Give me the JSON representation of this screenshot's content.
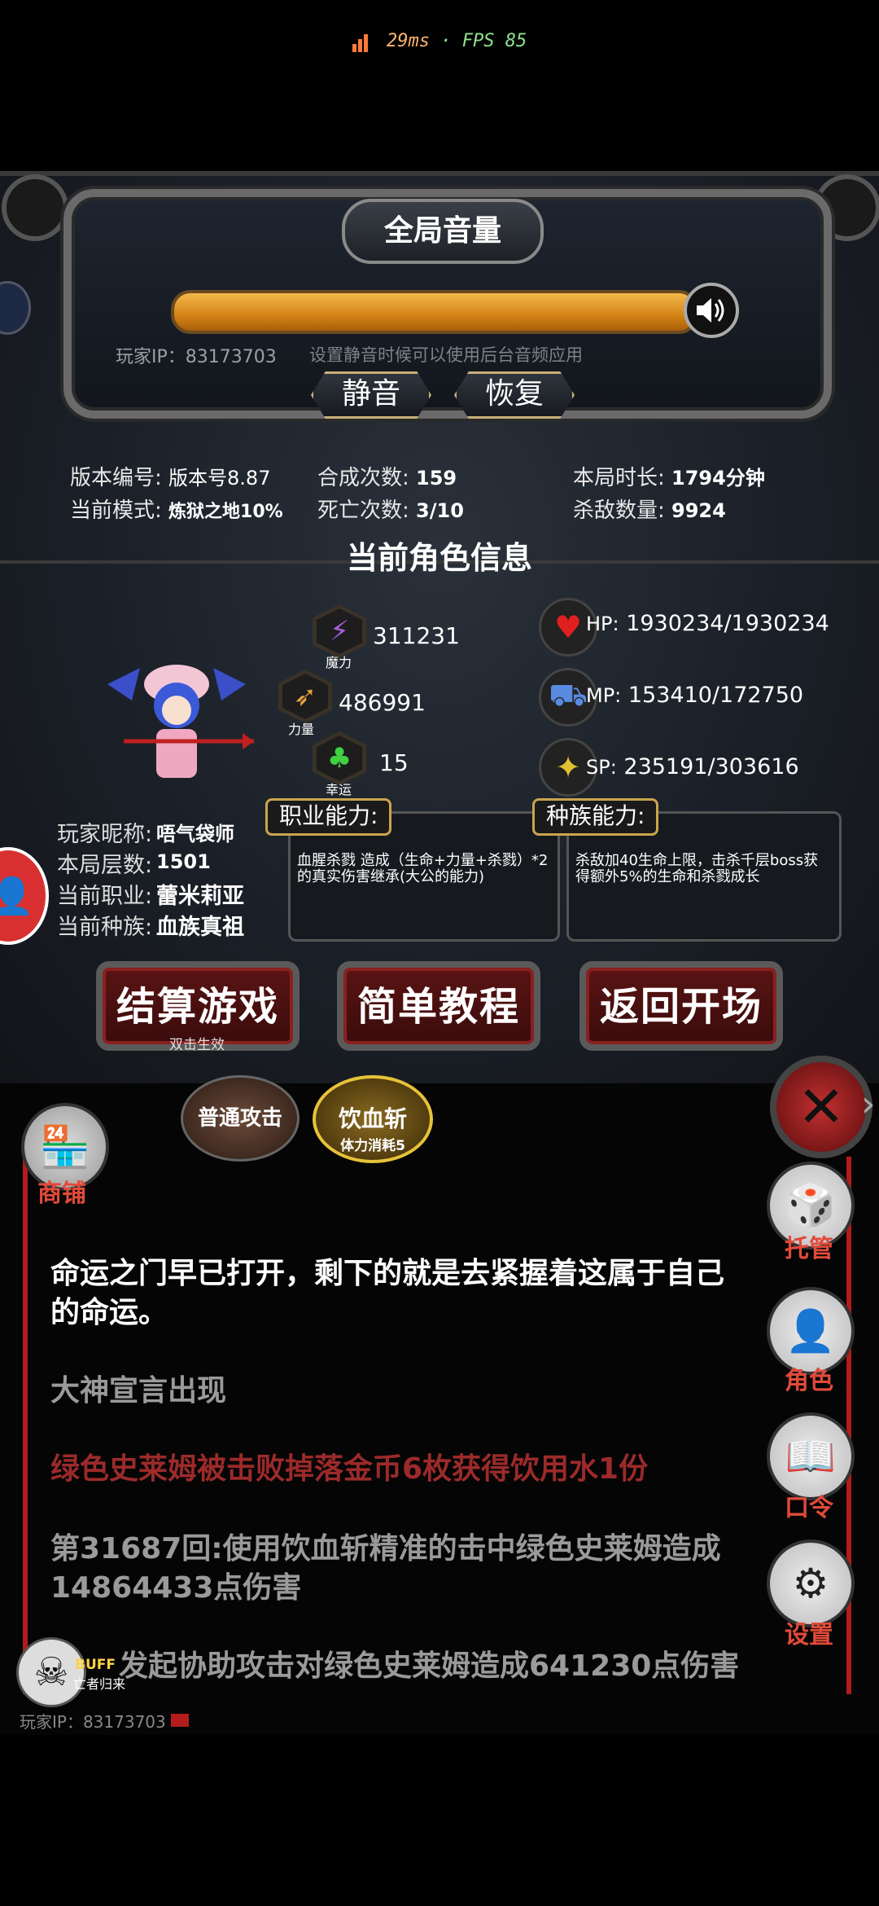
{
  "status_bar": {
    "ping": "29ms",
    "separator": "·",
    "fps": "FPS 85"
  },
  "volume": {
    "title": "全局音量",
    "level": 1.0,
    "ip_text": "玩家IP：83173703",
    "hint": "设置静音时候可以使用后台音频应用",
    "mute_label": "静音",
    "restore_label": "恢复"
  },
  "stats": {
    "version_label": "版本编号:",
    "version_value": "版本号8.87",
    "mode_label": "当前模式:",
    "mode_value": "炼狱之地10%",
    "synth_label": "合成次数:",
    "synth_value": "159",
    "death_label": "死亡次数:",
    "death_value": "3/10",
    "time_label": "本局时长:",
    "time_value": "1794分钟",
    "kills_label": "杀敌数量:",
    "kills_value": "9924"
  },
  "character": {
    "section_title": "当前角色信息",
    "magic": {
      "value": "311231",
      "caption": "魔力"
    },
    "strength": {
      "value": "486991",
      "caption": "力量"
    },
    "luck": {
      "value": "15",
      "caption": "幸运"
    },
    "hp": {
      "label": "HP:",
      "value": "1930234/1930234"
    },
    "mp": {
      "label": "MP:",
      "value": "153410/172750"
    },
    "sp": {
      "label": "SP:",
      "value": "235191/303616"
    },
    "nickname_label": "玩家昵称:",
    "nickname": "唔气袋师",
    "floor_label": "本局层数:",
    "floor": "1501",
    "job_label": "当前职业:",
    "job": "蕾米莉亚",
    "race_label": "当前种族:",
    "race": "血族真祖",
    "job_ability_tab": "职业能力:",
    "race_ability_tab": "种族能力:",
    "job_ability_text": "血腥杀戮 造成（生命+力量+杀戮）*2的真实伤害继承(大公的能力)",
    "race_ability_text": "杀敌加40生命上限，击杀千层boss获得额外5%的生命和杀戮成长"
  },
  "actions": {
    "settle_label": "结算游戏",
    "settle_hint": "双击生效",
    "tutorial_label": "简单教程",
    "return_label": "返回开场"
  },
  "skills": {
    "normal_attack": "普通攻击",
    "blood_slash": "饮血斩",
    "blood_slash_cost": "体力消耗5"
  },
  "side_menu": {
    "shop": "商铺",
    "auto": "托管",
    "role": "角色",
    "code": "口令",
    "settings": "设置"
  },
  "log": {
    "line1": "命运之门早已打开，剩下的就是去紧握着这属于自己的命运。",
    "line2": "大神宣言出现",
    "line3": "绿色史莱姆被击败掉落金币6枚获得饮用水1份",
    "line4": "第31687回:使用饮血斩精准的击中绿色史莱姆造成14864433点伤害",
    "line5": "发起协助攻击对绿色史莱姆造成641230点伤害"
  },
  "buff": {
    "label": "BUFF",
    "name": "亡者归来"
  },
  "footer_ip": "玩家IP：83173703",
  "colors": {
    "accent_gold": "#c9a54e",
    "log_red": "#9c2a2a",
    "slider_orange": "#e69a22"
  }
}
